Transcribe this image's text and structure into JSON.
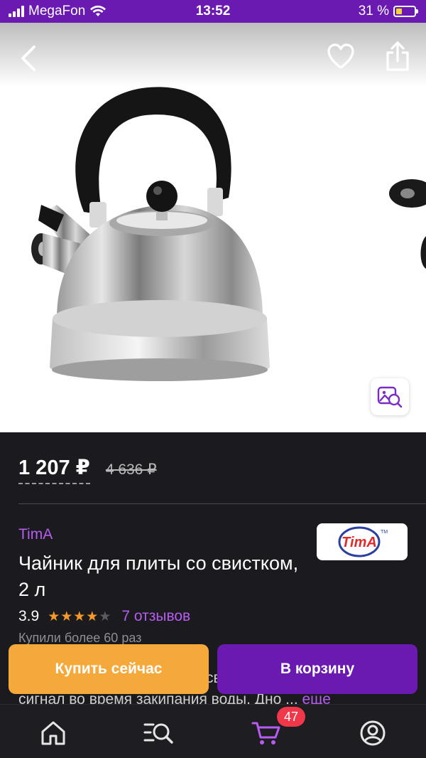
{
  "status_bar": {
    "carrier": "MegaFon",
    "time": "13:52",
    "battery": "31 %",
    "battery_level": 0.31
  },
  "product": {
    "price": "1 207 ₽",
    "old_price": "4 636 ₽",
    "brand": "TimA",
    "logo_text": "TimA",
    "logo_tm": "TM",
    "title": "Чайник для плиты со свистком, 2 л",
    "rating": "3.9",
    "rating_stars": 4,
    "reviews": "7 отзывов",
    "bought": "Купили более 60 раз",
    "description_peek": "св",
    "description_line": "сигнал во время закипания воды. Дно ...",
    "more": "еще"
  },
  "actions": {
    "buy_now": "Купить сейчас",
    "add_to_cart": "В корзину"
  },
  "tab_bar": {
    "cart_badge": "47",
    "items": [
      {
        "icon": "home-icon"
      },
      {
        "icon": "catalog-search-icon"
      },
      {
        "icon": "cart-icon",
        "active": true
      },
      {
        "icon": "profile-icon"
      }
    ]
  },
  "colors": {
    "accent": "#6a1ab0",
    "link": "#b65cf0",
    "buy": "#f6a93b",
    "badge": "#f0384a",
    "background": "#1b1b1f"
  }
}
